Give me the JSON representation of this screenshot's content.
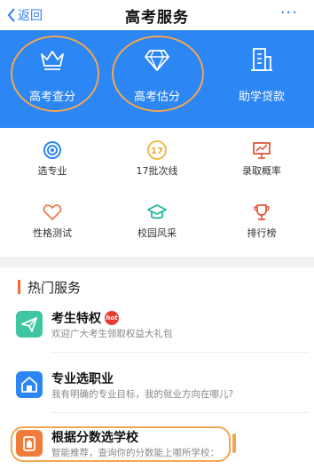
{
  "nav": {
    "back_label": "返回",
    "title": "高考服务",
    "more_label": "···"
  },
  "hero": [
    {
      "label": "高考查分",
      "icon": "crown-icon"
    },
    {
      "label": "高考估分",
      "icon": "diamond-icon"
    },
    {
      "label": "助学贷款",
      "icon": "building-icon"
    }
  ],
  "grid": [
    {
      "label": "选专业",
      "icon": "target-icon"
    },
    {
      "label": "17批次线",
      "icon": "badge-17-icon",
      "badge_text": "17"
    },
    {
      "label": "录取概率",
      "icon": "chart-board-icon"
    },
    {
      "label": "性格测试",
      "icon": "heart-icon"
    },
    {
      "label": "校园风采",
      "icon": "graduation-cap-icon"
    },
    {
      "label": "排行榜",
      "icon": "trophy-icon"
    }
  ],
  "section": {
    "title": "热门服务"
  },
  "services": [
    {
      "title": "考生特权",
      "desc": "欢迎广大考生领取权益大礼包",
      "badge": "hot",
      "icon": "paper-plane-icon",
      "color": "#3fc5a0"
    },
    {
      "title": "专业选职业",
      "desc": "我有明确的专业目标，我的就业方向在哪儿?",
      "icon": "house-icon",
      "color": "#2c86f4"
    },
    {
      "title": "根据分数选学校",
      "desc": "智能推荐，查询你的分数能上哪所学校：",
      "icon": "school-icon",
      "color": "#f07b3b"
    }
  ],
  "colors": {
    "brand_blue": "#2c86f4",
    "highlight_orange": "#f3a651"
  }
}
